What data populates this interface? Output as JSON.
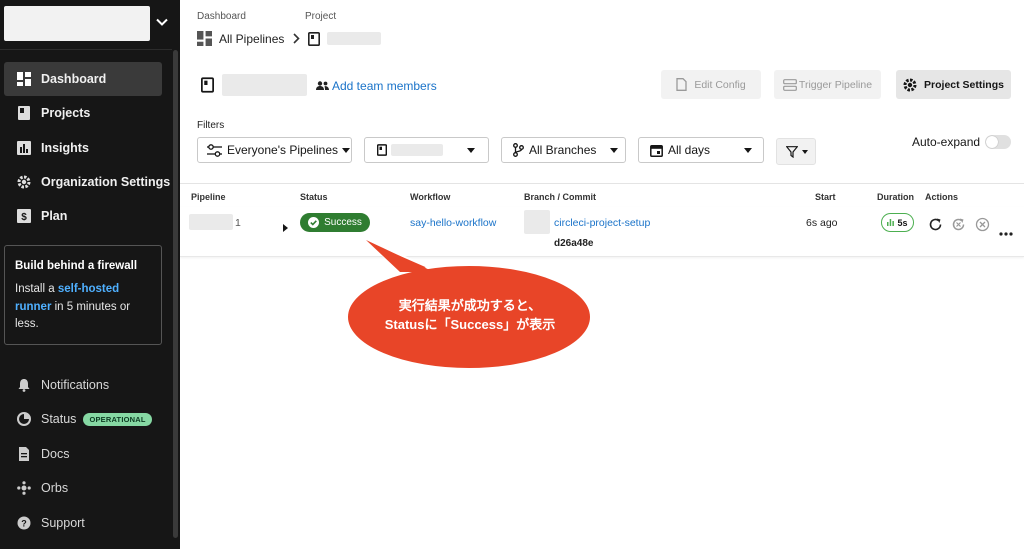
{
  "sidebar": {
    "items": [
      {
        "label": "Dashboard",
        "icon": "dashboard-icon"
      },
      {
        "label": "Projects",
        "icon": "projects-icon"
      },
      {
        "label": "Insights",
        "icon": "insights-icon"
      },
      {
        "label": "Organization Settings",
        "icon": "gear-icon"
      },
      {
        "label": "Plan",
        "icon": "plan-icon"
      }
    ],
    "firewall": {
      "title": "Build behind a firewall",
      "text_before": "Install a ",
      "link": "self-hosted runner",
      "text_after": " in 5 minutes or less."
    },
    "bottom_items": [
      {
        "label": "Notifications",
        "icon": "bell-icon"
      },
      {
        "label": "Status",
        "icon": "status-icon",
        "badge": "OPERATIONAL"
      },
      {
        "label": "Docs",
        "icon": "docs-icon"
      },
      {
        "label": "Orbs",
        "icon": "orbs-icon"
      },
      {
        "label": "Support",
        "icon": "support-icon"
      }
    ]
  },
  "breadcrumb": {
    "dashboard_label": "Dashboard",
    "project_label": "Project",
    "pipelines": "All Pipelines"
  },
  "header": {
    "add_team": "Add team members",
    "edit_config": "Edit Config",
    "trigger_pipeline": "Trigger Pipeline",
    "project_settings": "Project Settings"
  },
  "filters": {
    "label": "Filters",
    "pipelines": "Everyone's Pipelines",
    "branches": "All Branches",
    "days": "All days",
    "auto_expand": "Auto-expand"
  },
  "table": {
    "headers": [
      "Pipeline",
      "Status",
      "Workflow",
      "Branch / Commit",
      "Start",
      "Duration",
      "Actions"
    ],
    "row": {
      "pipeline_number": "1",
      "status": "Success",
      "workflow": "say-hello-workflow",
      "branch": "circleci-project-setup",
      "commit": "d26a48e",
      "start": "6s ago",
      "duration": "5s"
    }
  },
  "annotation": {
    "line1": "実行結果が成功すると、",
    "line2": "Statusに「Success」が表示"
  },
  "colors": {
    "sidebar_bg": "#161616",
    "success": "#2f7d31",
    "link": "#1a73c9",
    "callout": "#e84528"
  }
}
